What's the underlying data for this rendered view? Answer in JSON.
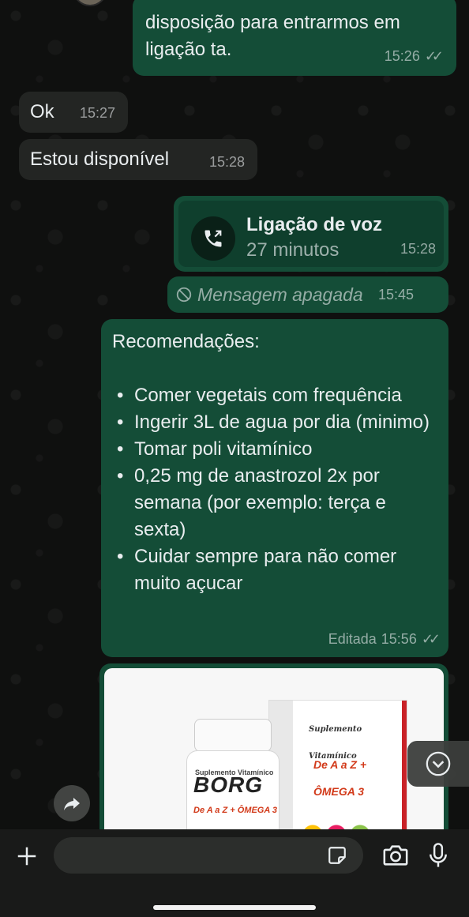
{
  "messages": {
    "m1": {
      "lines": [
        "disposição para entrarmos em",
        "ligação ta."
      ],
      "time": "15:26"
    },
    "m2": {
      "text": "Ok",
      "time": "15:27"
    },
    "m3": {
      "text": "Estou disponível",
      "time": "15:28"
    },
    "call": {
      "title": "Ligação de voz",
      "duration": "27 minutos",
      "time": "15:28"
    },
    "deleted": {
      "text": "Mensagem apagada",
      "time": "15:45"
    },
    "recommendations": {
      "title": "Recomendações:",
      "items": [
        "Comer vegetais com frequência",
        "Ingerir 3L de agua por dia (minimo)",
        "Tomar poli vitamínico",
        "0,25 mg de anastrozol 2x por semana (por exemplo: terça e sexta)",
        "Cuidar sempre para não comer muito açucar"
      ],
      "edited_label": "Editada",
      "time": "15:56"
    },
    "image": {
      "box_label": "Suplemento Vitamínico",
      "box_sub": "De A a Z + ÔMEGA 3",
      "bottle_label": "Suplemento Vitamínico",
      "bottle_brand": "BORG",
      "bottle_sub": "De A a Z + ÔMEGA 3"
    }
  },
  "composer": {
    "placeholder": ""
  },
  "colors": {
    "outgoing": "#144d37",
    "incoming": "#232523",
    "background": "#0f100f"
  }
}
